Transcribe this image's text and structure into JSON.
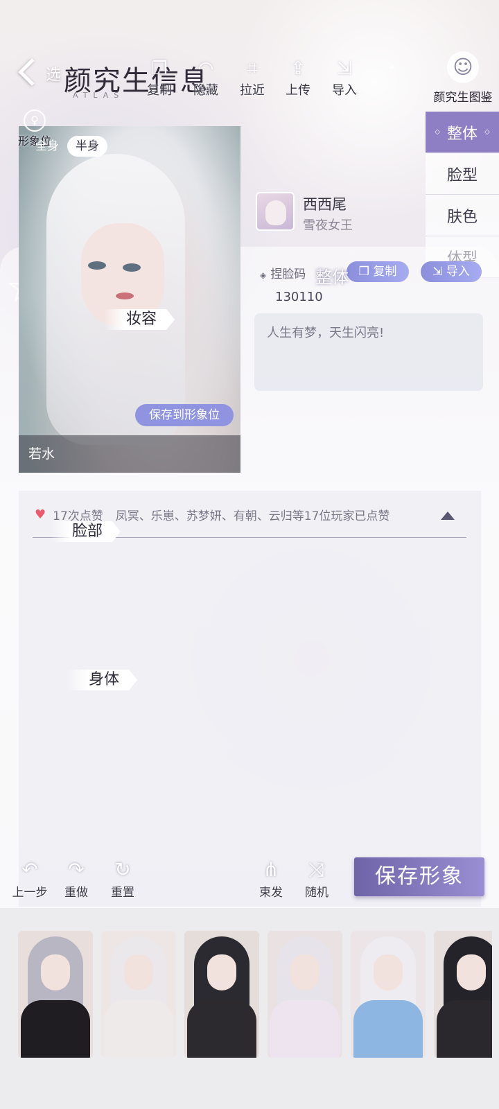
{
  "header": {
    "back_label": "选",
    "title": "颜究生信息",
    "subtitle": "ATLAS",
    "tools": [
      {
        "icon": "copy-icon",
        "label": "复制"
      },
      {
        "icon": "eye-hide-icon",
        "label": "隐藏"
      },
      {
        "icon": "zoom-in-icon",
        "label": "拉近"
      },
      {
        "icon": "upload-icon",
        "label": "上传"
      },
      {
        "icon": "import-icon",
        "label": "导入"
      }
    ],
    "gallery_label": "颜究生图鉴"
  },
  "side_tabs": [
    {
      "label": "整体",
      "active": true
    },
    {
      "label": "脸型",
      "active": false
    },
    {
      "label": "肤色",
      "active": false
    },
    {
      "label": "体型",
      "active": false
    }
  ],
  "portrait": {
    "slot_label": "形象位",
    "view_options": [
      "全身",
      "半身"
    ],
    "view_selected": "半身",
    "makeup_ribbon": "妆容",
    "save_slot_button": "保存到形象位",
    "caption": "若水"
  },
  "author": {
    "name": "西西尾",
    "title": "雪夜女王"
  },
  "info": {
    "face_code_label": "捏脸码",
    "overall_overlay": "整体",
    "copy_button": "复制",
    "import_button": "导入",
    "code_value": "130110",
    "signature": "人生有梦，天生闪亮!"
  },
  "likes": {
    "count_text": "17次点赞",
    "names_text": "凤冥、乐崽、苏梦妍、有朝、云归等17位玩家已点赞"
  },
  "sections": {
    "face": "脸部",
    "body": "身体"
  },
  "bottom_toolbar": {
    "undo": "上一步",
    "redo": "重做",
    "reset": "重置",
    "hair_tie": "束发",
    "random": "随机",
    "save_look": "保存形象"
  },
  "colors": {
    "accent_purple": "#8e7ec4",
    "pill_blue": "#8f93e0",
    "heart": "#e85a6c",
    "save_button": "#7a6fb4"
  },
  "presets": [
    {
      "name": "preset-1",
      "hair": "#b9b6c4",
      "body": "#1f1d22",
      "bg": "#e8dfdc"
    },
    {
      "name": "preset-2",
      "hair": "#ebe8ec",
      "body": "#eeeaea",
      "bg": "#ede6e4"
    },
    {
      "name": "preset-3",
      "hair": "#2b2a30",
      "body": "#2c2a2e",
      "bg": "#e4ddd9"
    },
    {
      "name": "preset-4",
      "hair": "#e6e3ea",
      "body": "#eee4ef",
      "bg": "#e9e1e2"
    },
    {
      "name": "preset-5",
      "hair": "#eeecf0",
      "body": "#8db6e2",
      "bg": "#ebe5e7"
    },
    {
      "name": "preset-6",
      "hair": "#242329",
      "body": "#2a282c",
      "bg": "#e6dfdd"
    }
  ]
}
